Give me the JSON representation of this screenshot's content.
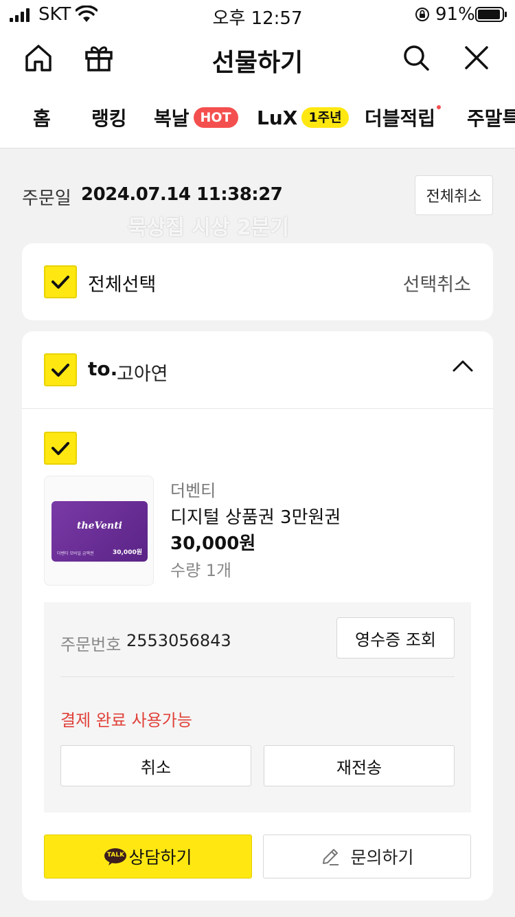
{
  "status_bar": {
    "carrier": "SKT",
    "time": "오후 12:57",
    "battery": "91%"
  },
  "nav": {
    "title": "선물하기"
  },
  "tabs": [
    {
      "label": "홈"
    },
    {
      "label": "랭킹"
    },
    {
      "label": "복날",
      "badge": "HOT"
    },
    {
      "label": "LuX",
      "badge": "1주년"
    },
    {
      "label": "더블적립"
    },
    {
      "label": "주말특"
    }
  ],
  "order": {
    "date_label": "주문일",
    "date": "2024.07.14  11:38:27",
    "cancel_all": "전체취소",
    "watermark": "묵상집 시상 2분기"
  },
  "select_bar": {
    "select_all": "전체선택",
    "select_cancel": "선택취소"
  },
  "recipient": {
    "prefix": "to.",
    "name": "고아연"
  },
  "item": {
    "brand": "더벤티",
    "name": "디지털 상품권 3만원권",
    "price": "30,000원",
    "quantity": "수량 1개",
    "card_logo": "theVenti",
    "card_small_text": "더벤티 모바일 금액권",
    "card_amount": "30,000원"
  },
  "detail": {
    "order_number_label": "주문번호",
    "order_number": "2553056843",
    "receipt_button": "영수증 조회",
    "status": "결제 완료 사용가능",
    "cancel_button": "취소",
    "resend_button": "재전송"
  },
  "actions": {
    "talk_badge": "TALK",
    "consult": "상담하기",
    "inquiry": "문의하기"
  },
  "colors": {
    "accent_yellow": "#ffe812",
    "hot_red": "#f44f4f",
    "status_red": "#e0423a"
  }
}
